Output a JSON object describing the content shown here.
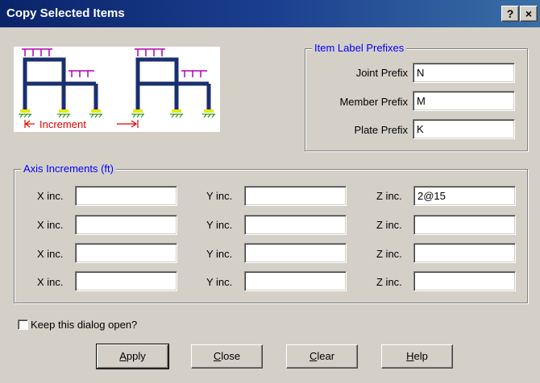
{
  "window": {
    "title": "Copy Selected Items",
    "help_glyph": "?",
    "close_glyph": "×"
  },
  "prefixes": {
    "legend": "Item Label Prefixes",
    "joint_label": "Joint Prefix",
    "joint_value": "N",
    "member_label": "Member Prefix",
    "member_value": "M",
    "plate_label": "Plate Prefix",
    "plate_value": "K"
  },
  "diagram": {
    "caption": "Increment"
  },
  "axis": {
    "legend": "Axis Increments  (ft)",
    "x_label": "X inc.",
    "y_label": "Y inc.",
    "z_label": "Z inc.",
    "rows": [
      {
        "x": "",
        "y": "",
        "z": "2@15"
      },
      {
        "x": "",
        "y": "",
        "z": ""
      },
      {
        "x": "",
        "y": "",
        "z": ""
      },
      {
        "x": "",
        "y": "",
        "z": ""
      }
    ]
  },
  "keep_open": {
    "label": "Keep this dialog open?",
    "checked": false
  },
  "buttons": {
    "apply": "Apply",
    "close": "Close",
    "clear": "Clear",
    "help": "Help"
  }
}
